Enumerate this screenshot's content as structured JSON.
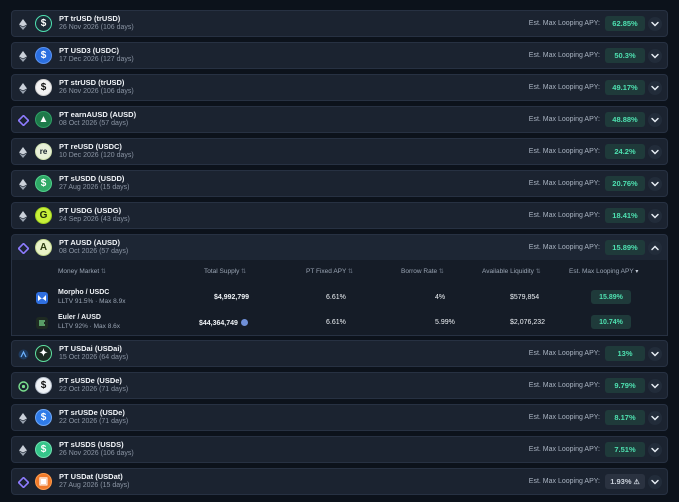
{
  "rows": [
    {
      "name": "PT trUSD (trUSD)",
      "date": "26 Nov 2026 (106 days)",
      "apy_label": "Est. Max Looping APY:",
      "apy": "62.85%",
      "chain": "ethereum-icon",
      "token_icon": "dollar-icon",
      "token_color": "#1c2a36",
      "token_border": "#4ee0b0",
      "token_glyph": "$",
      "expanded": false
    },
    {
      "name": "PT USD3 (USDC)",
      "date": "17 Dec 2026 (127 days)",
      "apy_label": "Est. Max Looping APY:",
      "apy": "50.3%",
      "chain": "ethereum-icon",
      "token_icon": "dollar-icon",
      "token_color": "#2b6fe0",
      "token_border": "#5b93f0",
      "token_glyph": "$",
      "expanded": false
    },
    {
      "name": "PT strUSD (trUSD)",
      "date": "26 Nov 2026 (106 days)",
      "apy_label": "Est. Max Looping APY:",
      "apy": "49.17%",
      "chain": "ethereum-icon",
      "token_icon": "dollar-icon",
      "token_color": "#f2f2f2",
      "token_border": "#cfcfcf",
      "token_glyph": "$",
      "glyph_color": "#111",
      "expanded": false
    },
    {
      "name": "PT earnAUSD (AUSD)",
      "date": "08 Oct 2026 (57 days)",
      "apy_label": "Est. Max Looping APY:",
      "apy": "48.88%",
      "chain": "monad-icon",
      "token_icon": "tree-icon",
      "token_color": "#1e7a4a",
      "token_border": "#2fa066",
      "token_glyph": "▲",
      "expanded": false
    },
    {
      "name": "PT reUSD (USDC)",
      "date": "10 Dec 2026 (120 days)",
      "apy_label": "Est. Max Looping APY:",
      "apy": "24.2%",
      "chain": "ethereum-icon",
      "token_icon": "re-icon",
      "token_color": "#e8f0d8",
      "token_border": "#cfe0b0",
      "token_glyph": "re",
      "glyph_color": "#15202b",
      "expanded": false
    },
    {
      "name": "PT sUSDD (USDD)",
      "date": "27 Aug 2026 (15 days)",
      "apy_label": "Est. Max Looping APY:",
      "apy": "20.76%",
      "chain": "ethereum-icon",
      "token_icon": "dollar-icon",
      "token_color": "#2fa866",
      "token_border": "#4fd08a",
      "token_glyph": "$",
      "expanded": false
    },
    {
      "name": "PT USDG (USDG)",
      "date": "24 Sep 2026 (43 days)",
      "apy_label": "Est. Max Looping APY:",
      "apy": "18.41%",
      "chain": "ethereum-icon",
      "token_icon": "g-icon",
      "token_color": "#c8f03a",
      "token_border": "#a0d020",
      "token_glyph": "G",
      "glyph_color": "#1a2a0a",
      "expanded": false
    },
    {
      "name": "PT AUSD (AUSD)",
      "date": "08 Oct 2026 (57 days)",
      "apy_label": "Est. Max Looping APY:",
      "apy": "15.89%",
      "chain": "monad-icon",
      "token_icon": "a-icon",
      "token_color": "#e9f3c8",
      "token_border": "#c4d890",
      "token_glyph": "A",
      "glyph_color": "#2a3a10",
      "expanded": true
    },
    {
      "name": "PT USDai (USDai)",
      "date": "15 Oct 2026 (64 days)",
      "apy_label": "Est. Max Looping APY:",
      "apy": "13%",
      "chain": "arbitrum-icon",
      "token_icon": "wing-icon",
      "token_color": "#1c2a22",
      "token_border": "#5ee0a0",
      "token_glyph": "✦",
      "expanded": false
    },
    {
      "name": "PT sUSDe (USDe)",
      "date": "22 Oct 2026 (71 days)",
      "apy_label": "Est. Max Looping APY:",
      "apy": "9.79%",
      "chain": "plasma-icon",
      "token_icon": "dollar-icon",
      "token_color": "#eef2f6",
      "token_border": "#b8c0cc",
      "token_glyph": "$",
      "glyph_color": "#111",
      "expanded": false
    },
    {
      "name": "PT srUSDe (USDe)",
      "date": "22 Oct 2026 (71 days)",
      "apy_label": "Est. Max Looping APY:",
      "apy": "8.17%",
      "chain": "ethereum-icon",
      "token_icon": "dollar-icon",
      "token_color": "#2f7be8",
      "token_border": "#6ea6f5",
      "token_glyph": "$",
      "expanded": false
    },
    {
      "name": "PT sUSDS (USDS)",
      "date": "26 Nov 2026 (106 days)",
      "apy_label": "Est. Max Looping APY:",
      "apy": "7.51%",
      "chain": "ethereum-icon",
      "token_icon": "dollar-icon",
      "token_color": "#35c58a",
      "token_border": "#6ee0b0",
      "token_glyph": "$",
      "expanded": false
    },
    {
      "name": "PT USDat (USDat)",
      "date": "27 Aug 2026 (15 days)",
      "apy_label": "Est. Max Looping APY:",
      "apy": "1.93%",
      "apy_warning": "⚠",
      "chain": "monad-icon",
      "token_icon": "square-icon",
      "token_color": "#f07a2a",
      "token_border": "#ff9a4a",
      "token_glyph": "▣",
      "expanded": false
    }
  ],
  "table": {
    "headers": {
      "market": "Money Market",
      "supply": "Total Supply",
      "fixed": "PT Fixed APY",
      "borrow": "Borrow Rate",
      "liquidity": "Available Liquidity",
      "looping": "Est. Max Looping APY"
    },
    "markets": [
      {
        "name": "Morpho / USDC",
        "lltv": "LLTV 91.5% · Max 8.9x",
        "supply": "$4,992,799",
        "fixed": "6.61%",
        "borrow": "4%",
        "liquidity": "$579,854",
        "looping": "15.89%",
        "icon": "morpho-icon",
        "icon_color": "#2f6fe0"
      },
      {
        "name": "Euler / AUSD",
        "lltv": "LLTV 92% · Max 8.6x",
        "supply": "$44,364,749",
        "fixed": "6.61%",
        "borrow": "5.99%",
        "liquidity": "$2,076,232",
        "looping": "10.74%",
        "icon": "euler-icon",
        "icon_color": "#1e2a22"
      }
    ]
  },
  "colors": {
    "accent_green": "#4ee0b0",
    "pill_bg": "#1f3a3a",
    "row_bg": "#1b2330",
    "page_bg": "#0c121b"
  }
}
